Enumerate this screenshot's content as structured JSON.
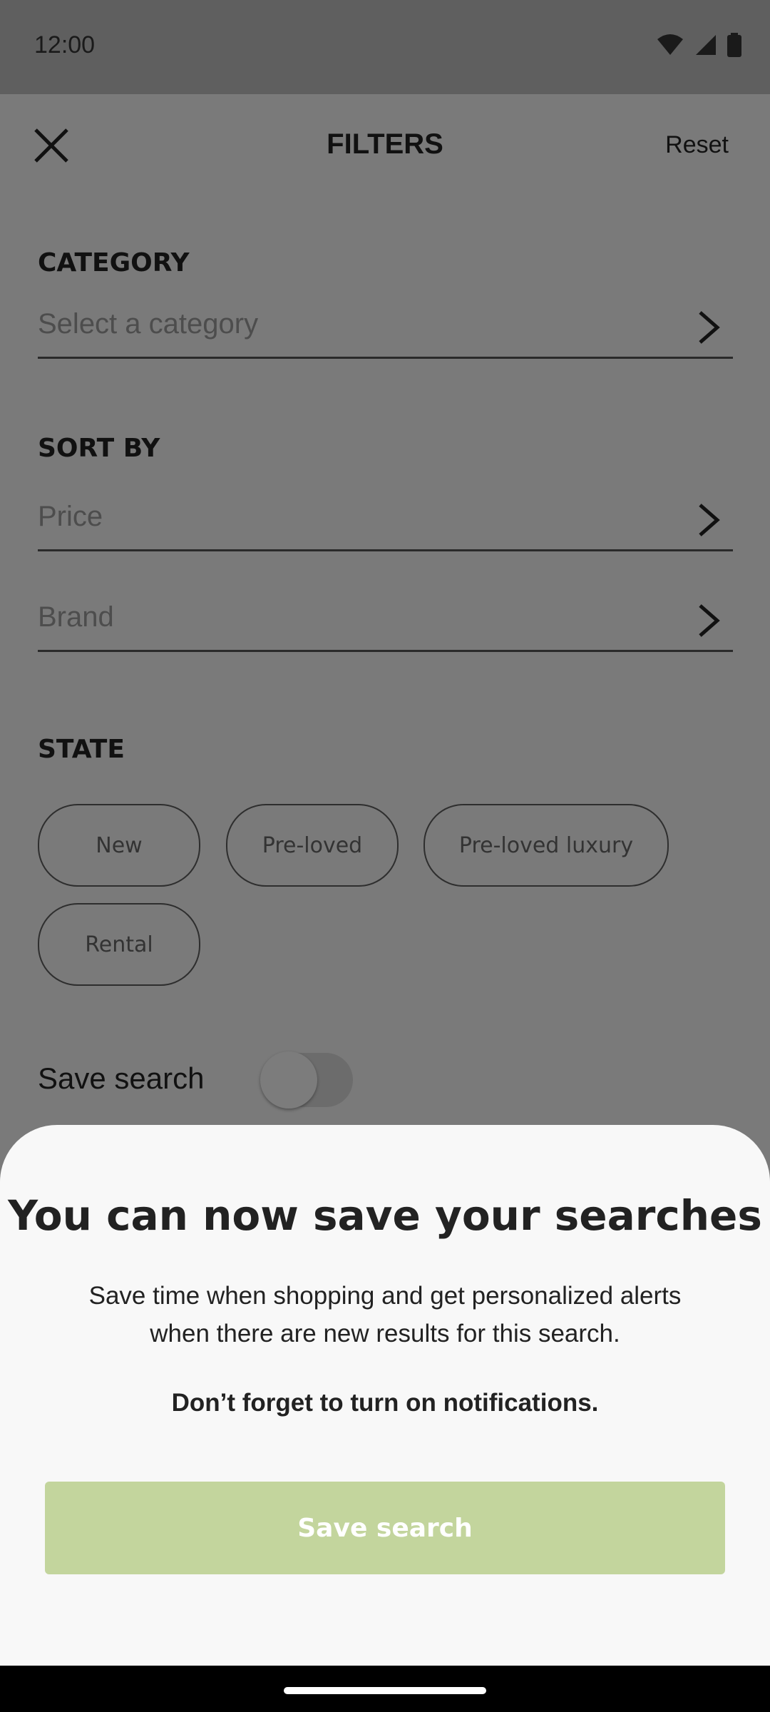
{
  "status_bar": {
    "time": "12:00"
  },
  "header": {
    "title": "FILTERS",
    "reset_label": "Reset"
  },
  "category": {
    "label": "CATEGORY",
    "placeholder": "Select a category"
  },
  "sort_by": {
    "label": "SORT BY",
    "price_placeholder": "Price",
    "brand_placeholder": "Brand"
  },
  "state": {
    "label": "STATE",
    "chips": [
      "New",
      "Pre-loved",
      "Pre-loved luxury",
      "Rental"
    ]
  },
  "save_search_row": {
    "label": "Save search",
    "enabled": false
  },
  "sheet": {
    "title": "You can now save your searches",
    "body": "Save time when shopping and get personalized alerts when there are new results for this search.",
    "note": "Don’t forget to turn on notifications.",
    "button_label": "Save search",
    "button_color": "#c3d59d"
  },
  "icons": [
    "close-icon",
    "chevron-right-icon",
    "wifi-icon",
    "signal-icon",
    "battery-icon"
  ]
}
